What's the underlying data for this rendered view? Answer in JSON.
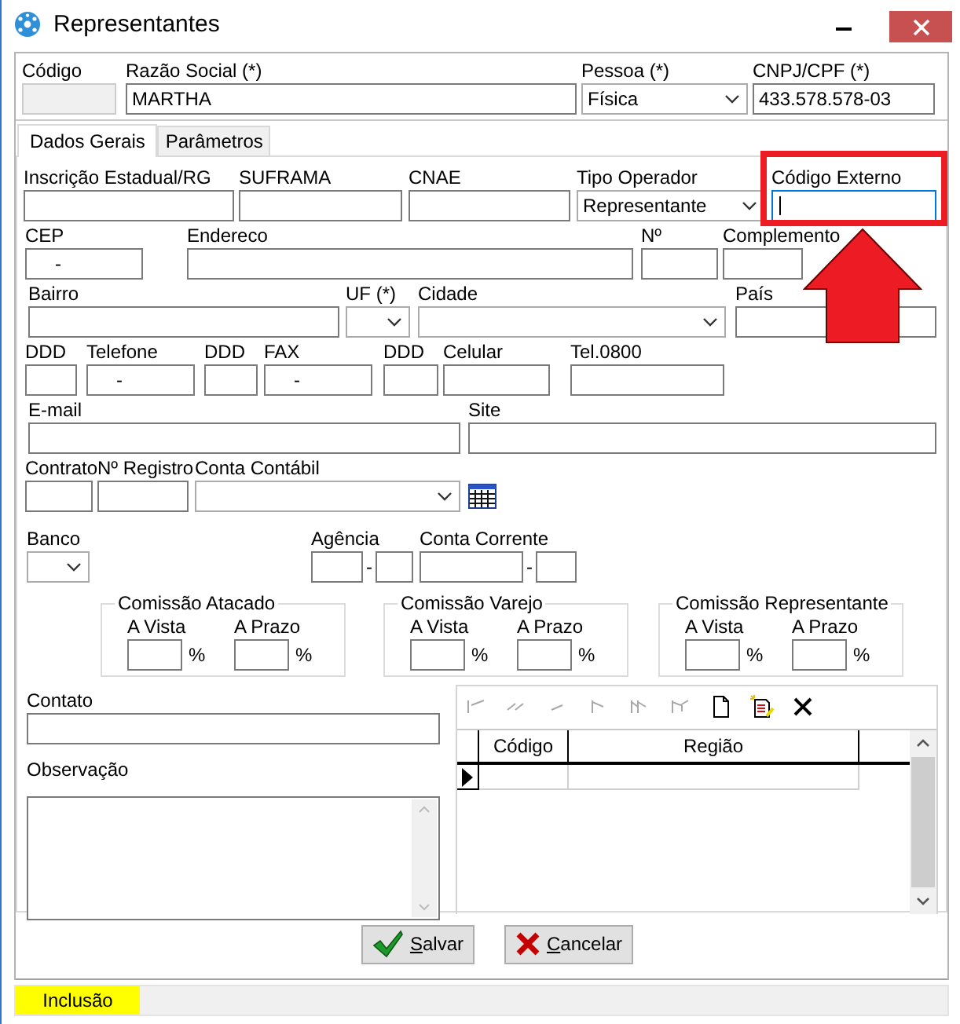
{
  "window": {
    "title": "Representantes"
  },
  "header_fields": [
    {
      "label": "Código",
      "kind": "text",
      "disabled": true
    },
    {
      "label": "Razão Social (*)",
      "kind": "text",
      "value": "MARTHA",
      "disabled": false
    },
    {
      "label": "Pessoa (*)",
      "kind": "combo",
      "value": "Física",
      "disabled": false
    },
    {
      "label": "CNPJ/CPF (*)",
      "kind": "text",
      "value": "433.578.578-03",
      "disabled": false
    }
  ],
  "tabs": [
    {
      "label": "Dados Gerais",
      "selected": true
    },
    {
      "label": "Parâmetros",
      "selected": false
    }
  ],
  "form_rows": [
    [
      {
        "label": "Inscrição Estadual/RG",
        "kind": "text",
        "focused": false
      },
      {
        "label": "SUFRAMA",
        "kind": "text",
        "focused": false
      },
      {
        "label": "CNAE",
        "kind": "text",
        "focused": false
      },
      {
        "label": "Tipo Operador",
        "kind": "combo",
        "value": "Representante",
        "focused": false
      },
      {
        "label": "Código Externo",
        "kind": "text",
        "focused": true
      }
    ],
    [
      {
        "label": "CEP",
        "kind": "masked",
        "value": "-",
        "focused": false
      },
      {
        "label": "Endereco",
        "kind": "text",
        "focused": false
      },
      {
        "label": "Nº",
        "kind": "text",
        "focused": false
      },
      {
        "label": "Complemento",
        "kind": "text",
        "focused": false
      }
    ],
    [
      {
        "label": "Bairro",
        "kind": "text",
        "focused": false
      },
      {
        "label": "UF (*)",
        "kind": "combo",
        "focused": false
      },
      {
        "label": "Cidade",
        "kind": "combo",
        "focused": false
      },
      {
        "label": "País",
        "kind": "text",
        "focused": false
      }
    ],
    [
      {
        "label": "DDD",
        "kind": "text",
        "focused": false
      },
      {
        "label": "Telefone",
        "kind": "masked",
        "value": "-",
        "focused": false
      },
      {
        "label": "DDD",
        "kind": "text",
        "focused": false
      },
      {
        "label": "FAX",
        "kind": "masked",
        "value": "-",
        "focused": false
      },
      {
        "label": "DDD",
        "kind": "text",
        "focused": false
      },
      {
        "label": "Celular",
        "kind": "text",
        "focused": false
      },
      {
        "label": "Tel.0800",
        "kind": "text",
        "focused": false
      }
    ],
    [
      {
        "label": "E-mail",
        "kind": "text",
        "focused": false
      },
      {
        "label": "Site",
        "kind": "text",
        "focused": false
      }
    ],
    [
      {
        "label": "Contrato",
        "kind": "text",
        "focused": false
      },
      {
        "label": "Nº Registro",
        "kind": "text",
        "focused": false
      },
      {
        "label": "Conta Contábil",
        "kind": "combo",
        "focused": false
      },
      {
        "kind": "lookup"
      }
    ],
    [
      {
        "label": "Banco",
        "kind": "combo",
        "focused": false
      },
      {
        "label": "Agência",
        "kind": "split",
        "separator": "-",
        "focused": false
      },
      {
        "label": "Conta Corrente",
        "kind": "split",
        "separator": "-",
        "focused": false
      }
    ]
  ],
  "commission_groups": [
    {
      "title": "Comissão Atacado",
      "fields": [
        {
          "label": "A Vista",
          "unit": "%"
        },
        {
          "label": "A Prazo",
          "unit": "%"
        }
      ]
    },
    {
      "title": "Comissão Varejo",
      "fields": [
        {
          "label": "A Vista",
          "unit": "%"
        },
        {
          "label": "A Prazo",
          "unit": "%"
        }
      ]
    },
    {
      "title": "Comissão Representante",
      "fields": [
        {
          "label": "A Vista",
          "unit": "%"
        },
        {
          "label": "A Prazo",
          "unit": "%"
        }
      ]
    }
  ],
  "contact": {
    "label": "Contato"
  },
  "notes": {
    "label": "Observação"
  },
  "detail_grid": {
    "toolbar": [
      {
        "kind": "first",
        "disabled": true
      },
      {
        "kind": "prior",
        "disabled": true
      },
      {
        "kind": "next",
        "disabled": true
      },
      {
        "kind": "last",
        "disabled": true
      },
      {
        "kind": "post",
        "disabled": true
      },
      {
        "kind": "cancel",
        "disabled": true
      },
      {
        "kind": "insert",
        "disabled": false
      },
      {
        "kind": "edit",
        "disabled": false
      },
      {
        "kind": "delete",
        "disabled": false
      }
    ],
    "columns": [
      "Código",
      "Região"
    ],
    "rows": [
      {
        "selected": true
      }
    ]
  },
  "buttons": [
    {
      "kind": "save",
      "label": "Salvar"
    },
    {
      "kind": "cancel",
      "label": "Cancelar"
    }
  ],
  "status_bar": {
    "mode": "Inclusão"
  },
  "annotation": {
    "highlight_box": true,
    "arrow": true
  }
}
